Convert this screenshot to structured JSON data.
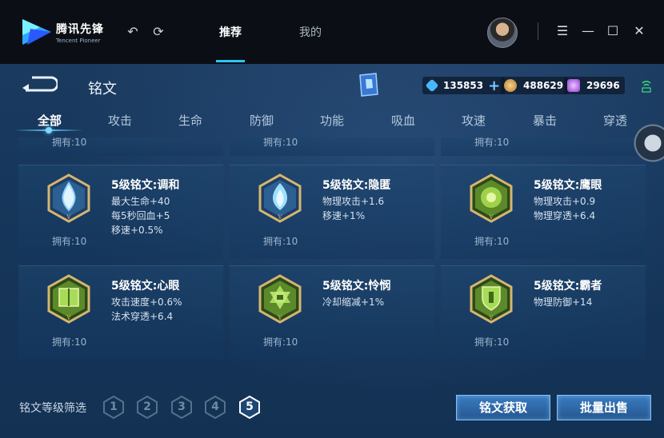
{
  "app": {
    "brand_cn": "腾讯先锋",
    "brand_en": "Tencent Pioneer",
    "tabs": [
      {
        "label": "推荐",
        "active": true
      },
      {
        "label": "我的",
        "active": false
      }
    ],
    "accent": "#2cc6ff"
  },
  "page": {
    "title": "铭文",
    "currencies": [
      {
        "icon": "diamond-coupon-icon",
        "value": "135853",
        "color": "#49b7ff"
      },
      {
        "icon": "gold-coin-icon",
        "value": "488629",
        "color": "#d8a84e"
      },
      {
        "icon": "gem-icon",
        "value": "29696",
        "color": "#c27cf0"
      }
    ],
    "categories": [
      "全部",
      "攻击",
      "生命",
      "防御",
      "功能",
      "吸血",
      "攻速",
      "暴击",
      "穿透"
    ],
    "active_category": "全部",
    "partial_cards": [
      {
        "owned": "拥有:10"
      },
      {
        "owned": "拥有:10"
      },
      {
        "owned": "拥有:10"
      }
    ],
    "cards": [
      {
        "name": "5级铭文:调和",
        "stats": [
          "最大生命+40",
          "每5秒回血+5",
          "移速+0.5%"
        ],
        "owned": "拥有:10",
        "gem": "blue-drop"
      },
      {
        "name": "5级铭文:隐匿",
        "stats": [
          "物理攻击+1.6",
          "移速+1%"
        ],
        "owned": "拥有:10",
        "gem": "blue-flame"
      },
      {
        "name": "5级铭文:鹰眼",
        "stats": [
          "物理攻击+0.9",
          "物理穿透+6.4"
        ],
        "owned": "拥有:10",
        "gem": "green-flower"
      },
      {
        "name": "5级铭文:心眼",
        "stats": [
          "攻击速度+0.6%",
          "法术穿透+6.4"
        ],
        "owned": "拥有:10",
        "gem": "green-book"
      },
      {
        "name": "5级铭文:怜悯",
        "stats": [
          "冷却缩减+1%"
        ],
        "owned": "拥有:10",
        "gem": "green-hourglass"
      },
      {
        "name": "5级铭文:霸者",
        "stats": [
          "物理防御+14"
        ],
        "owned": "拥有:10",
        "gem": "green-shield"
      }
    ],
    "filter_label": "铭文等级筛选",
    "levels": [
      "1",
      "2",
      "3",
      "4",
      "5"
    ],
    "active_level": "5",
    "buttons": {
      "acquire": "铭文获取",
      "bulk_sell": "批量出售"
    }
  }
}
